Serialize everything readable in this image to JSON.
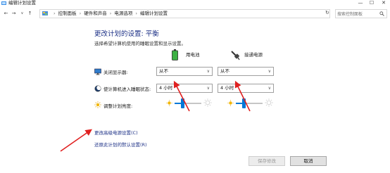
{
  "window": {
    "title": "编辑计划设置",
    "controls": {
      "minimize": "—",
      "maximize": "☐",
      "close": "✕"
    }
  },
  "nav": {
    "back": "←",
    "forward": "→",
    "recent": "∨",
    "up": "↑",
    "refresh": "↻",
    "breadcrumbs": [
      "控制面板",
      "硬件和声音",
      "电源选项",
      "编辑计划设置"
    ],
    "separator": "›",
    "search_placeholder": "搜索控制面板"
  },
  "main": {
    "heading": "更改计划的设置: 平衡",
    "subheading": "选择希望计算机使用的睡眠设置和显示设置。",
    "columns": [
      {
        "label": "用电池",
        "icon": "battery-icon"
      },
      {
        "label": "接通电源",
        "icon": "power-plug-icon"
      }
    ],
    "rows": {
      "display_off": {
        "label": "关闭显示器:",
        "icon": "monitor-icon",
        "battery": "从不",
        "plugged": "从不"
      },
      "sleep": {
        "label": "使计算机进入睡眠状态:",
        "icon": "sleep-moon-icon",
        "battery": "4 小时",
        "plugged": "4 小时"
      },
      "brightness": {
        "label": "调整计划亮度:",
        "icon": "sun-icon",
        "battery_level": 0.3,
        "plugged_level": 0.3
      }
    },
    "dropdown_arrow": "∨",
    "links": {
      "advanced": "更改高级电源设置(C)",
      "restore": "还原此计划的默认设置(R)"
    }
  },
  "footer": {
    "save": "保存修改",
    "cancel": "取消"
  },
  "colors": {
    "heading": "#1e3287",
    "accent": "#0078d7",
    "annotation_arrow": "#e02020"
  }
}
